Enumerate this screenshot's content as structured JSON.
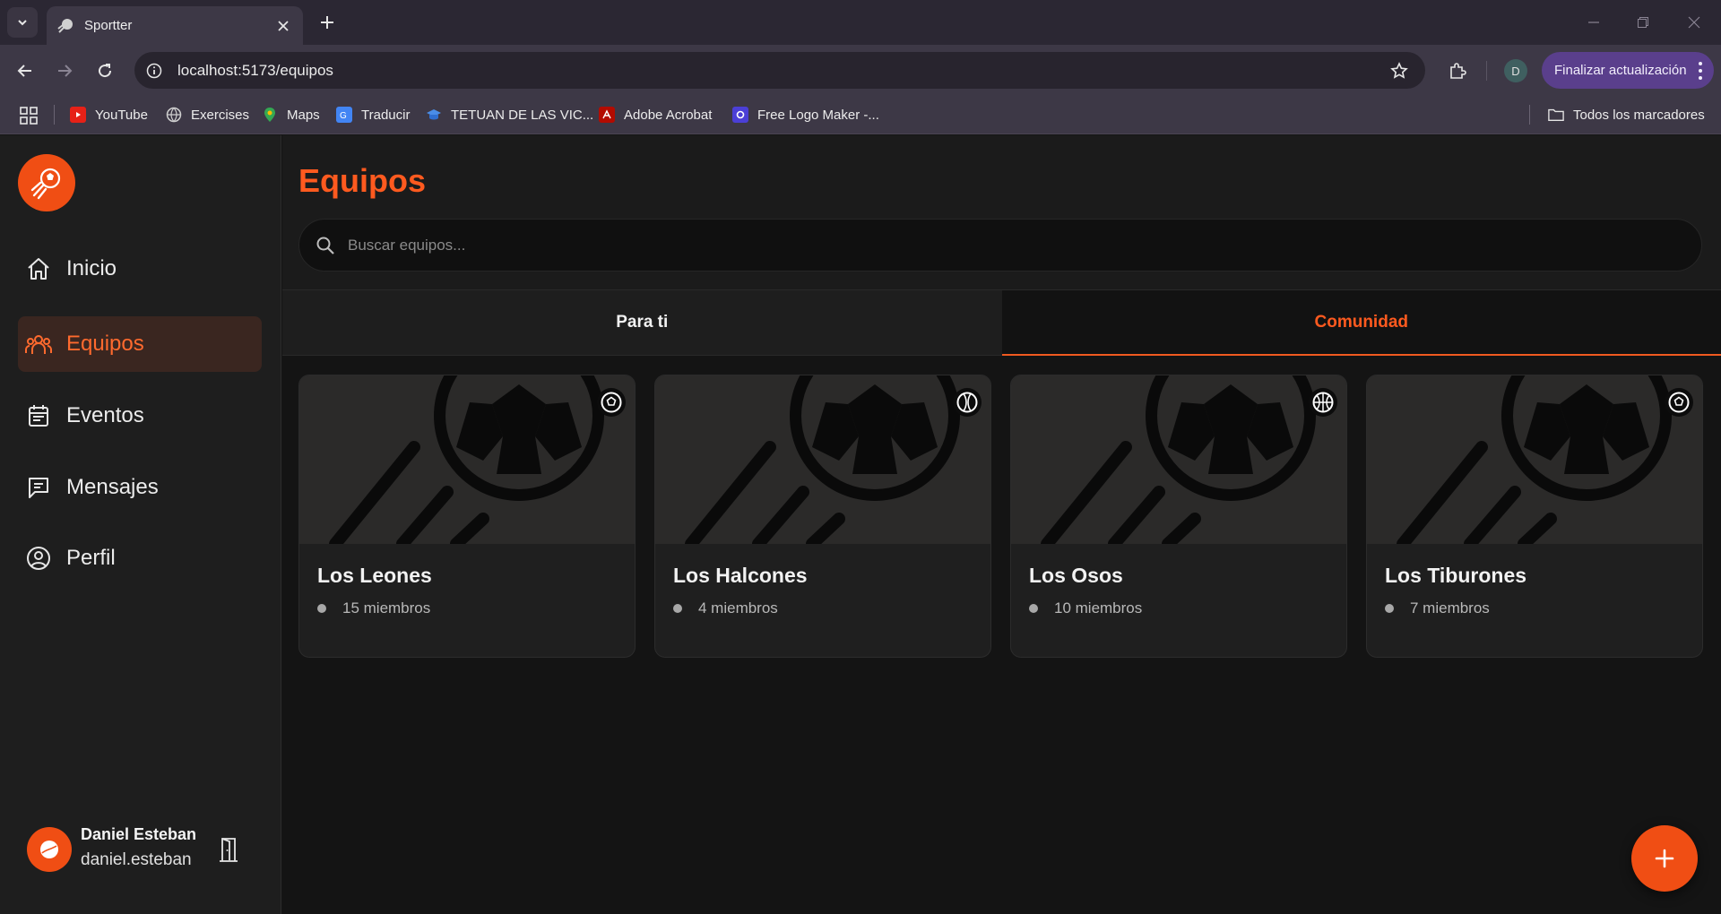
{
  "browser": {
    "tab_title": "Sportter",
    "url": "localhost:5173/equipos",
    "profile_initial": "D",
    "update_label": "Finalizar actualización",
    "bookmarks": [
      {
        "label": "YouTube",
        "icon": "youtube-icon"
      },
      {
        "label": "Exercises",
        "icon": "globe-icon"
      },
      {
        "label": "Maps",
        "icon": "maps-icon"
      },
      {
        "label": "Traducir",
        "icon": "translate-icon"
      },
      {
        "label": "TETUAN DE LAS VIC...",
        "icon": "school-icon"
      },
      {
        "label": "Adobe Acrobat",
        "icon": "acrobat-icon"
      },
      {
        "label": "Free Logo Maker -...",
        "icon": "logo-maker-icon"
      }
    ],
    "all_bookmarks_label": "Todos los marcadores"
  },
  "sidebar": {
    "nav": [
      {
        "label": "Inicio",
        "icon": "home-icon"
      },
      {
        "label": "Equipos",
        "icon": "team-icon"
      },
      {
        "label": "Eventos",
        "icon": "calendar-icon"
      },
      {
        "label": "Mensajes",
        "icon": "message-icon"
      },
      {
        "label": "Perfil",
        "icon": "profile-icon"
      }
    ],
    "active": "Equipos",
    "user": {
      "name": "Daniel Esteban",
      "email": "daniel.esteban"
    }
  },
  "main": {
    "title": "Equipos",
    "search_placeholder": "Buscar equipos...",
    "tabs": [
      {
        "label": "Para ti",
        "active": false
      },
      {
        "label": "Comunidad",
        "active": true
      }
    ],
    "teams": [
      {
        "name": "Los Leones",
        "members": "15 miembros",
        "sport_icon": "soccer-ball-icon"
      },
      {
        "name": "Los Halcones",
        "members": "4 miembros",
        "sport_icon": "tennis-ball-icon"
      },
      {
        "name": "Los Osos",
        "members": "10 miembros",
        "sport_icon": "basketball-icon"
      },
      {
        "name": "Los Tiburones",
        "members": "7 miembros",
        "sport_icon": "soccer-ball-icon"
      }
    ]
  },
  "colors": {
    "accent": "#f04e14",
    "accent_text": "#ff5a1f",
    "sidebar_bg": "#1e1e1e",
    "main_bg": "#141414"
  }
}
